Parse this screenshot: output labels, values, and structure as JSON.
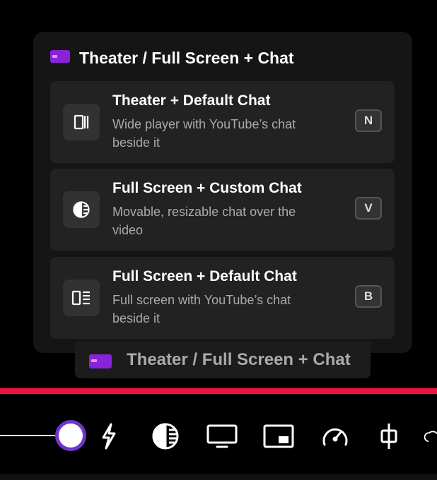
{
  "popup": {
    "title": "Theater / Full Screen + Chat",
    "icon": "purple-card-icon",
    "items": [
      {
        "title": "Theater + Default Chat",
        "description": "Wide player with YouTube’s chat beside it",
        "key": "N",
        "icon": "theater-layout-icon"
      },
      {
        "title": "Full Screen + Custom Chat",
        "description": "Movable, resizable chat over the video",
        "key": "V",
        "icon": "contrast-circle-icon"
      },
      {
        "title": "Full Screen + Default Chat",
        "description": "Full screen with YouTube’s chat beside it",
        "key": "B",
        "icon": "list-layout-icon"
      }
    ]
  },
  "tooltip": {
    "title": "Theater / Full Screen + Chat",
    "icon": "purple-card-icon"
  },
  "controls": {
    "icons": [
      "lightning-icon",
      "contrast-circle-icon",
      "monitor-icon",
      "miniplayer-icon",
      "speedometer-icon",
      "pin-icon",
      "cloud-icon"
    ]
  },
  "colors": {
    "accent_purple": "#6f37c8",
    "progress_red": "#f0133d",
    "popup_bg": "#151515",
    "item_bg": "#222222"
  }
}
